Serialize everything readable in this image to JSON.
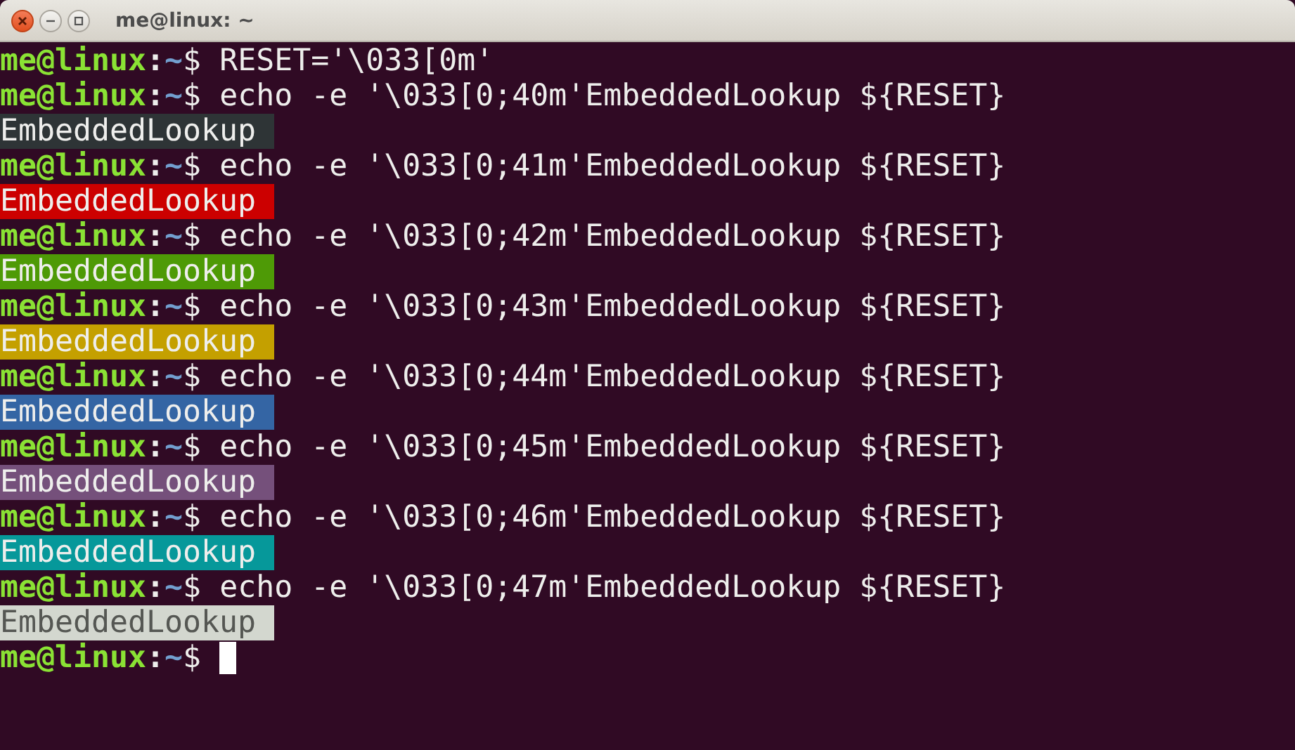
{
  "window": {
    "title": "me@linux: ~"
  },
  "lines": [
    {
      "kind": "command",
      "prompt": {
        "user": "me@linux",
        "separator": ":",
        "path": "~",
        "symbol": "$"
      },
      "command": "RESET='\\033[0m'"
    },
    {
      "kind": "command",
      "prompt": {
        "user": "me@linux",
        "separator": ":",
        "path": "~",
        "symbol": "$"
      },
      "command": "echo -e '\\033[0;40m'EmbeddedLookup ${RESET}"
    },
    {
      "kind": "output",
      "text": "EmbeddedLookup",
      "color": "#2e3436"
    },
    {
      "kind": "command",
      "prompt": {
        "user": "me@linux",
        "separator": ":",
        "path": "~",
        "symbol": "$"
      },
      "command": "echo -e '\\033[0;41m'EmbeddedLookup ${RESET}"
    },
    {
      "kind": "output",
      "text": "EmbeddedLookup",
      "color": "#cc0000"
    },
    {
      "kind": "command",
      "prompt": {
        "user": "me@linux",
        "separator": ":",
        "path": "~",
        "symbol": "$"
      },
      "command": "echo -e '\\033[0;42m'EmbeddedLookup ${RESET}"
    },
    {
      "kind": "output",
      "text": "EmbeddedLookup",
      "color": "#4e9a06"
    },
    {
      "kind": "command",
      "prompt": {
        "user": "me@linux",
        "separator": ":",
        "path": "~",
        "symbol": "$"
      },
      "command": "echo -e '\\033[0;43m'EmbeddedLookup ${RESET}"
    },
    {
      "kind": "output",
      "text": "EmbeddedLookup",
      "color": "#c4a000"
    },
    {
      "kind": "command",
      "prompt": {
        "user": "me@linux",
        "separator": ":",
        "path": "~",
        "symbol": "$"
      },
      "command": "echo -e '\\033[0;44m'EmbeddedLookup ${RESET}"
    },
    {
      "kind": "output",
      "text": "EmbeddedLookup",
      "color": "#3465a4"
    },
    {
      "kind": "command",
      "prompt": {
        "user": "me@linux",
        "separator": ":",
        "path": "~",
        "symbol": "$"
      },
      "command": "echo -e '\\033[0;45m'EmbeddedLookup ${RESET}"
    },
    {
      "kind": "output",
      "text": "EmbeddedLookup",
      "color": "#75507b"
    },
    {
      "kind": "command",
      "prompt": {
        "user": "me@linux",
        "separator": ":",
        "path": "~",
        "symbol": "$"
      },
      "command": "echo -e '\\033[0;46m'EmbeddedLookup ${RESET}"
    },
    {
      "kind": "output",
      "text": "EmbeddedLookup",
      "color": "#06989a"
    },
    {
      "kind": "command",
      "prompt": {
        "user": "me@linux",
        "separator": ":",
        "path": "~",
        "symbol": "$"
      },
      "command": "echo -e '\\033[0;47m'EmbeddedLookup ${RESET}"
    },
    {
      "kind": "output",
      "text": "EmbeddedLookup",
      "color": "#d3d7cf"
    },
    {
      "kind": "input",
      "prompt": {
        "user": "me@linux",
        "separator": ":",
        "path": "~",
        "symbol": "$"
      }
    }
  ]
}
